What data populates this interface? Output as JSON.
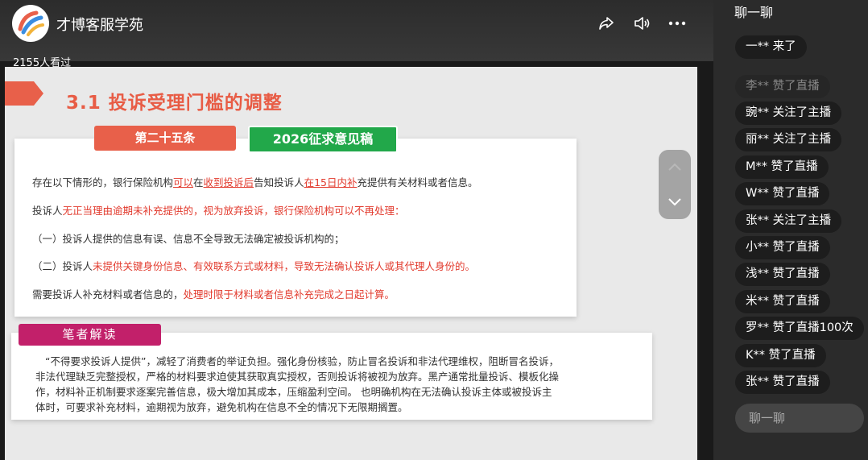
{
  "header": {
    "channel_name": "才博客服学苑",
    "viewers": "2155人看过",
    "share_icon": "share-icon",
    "volume_icon": "volume-icon",
    "more_icon": "more-icon"
  },
  "slide": {
    "title": "3.1 投诉受理门槛的调整",
    "tab_article": "第二十五条",
    "tab_draft": "2026征求意见稿",
    "p1": {
      "a": "存在以下情形的，银行保险机构",
      "b": "可以",
      "c": "在",
      "d": "收到投诉后",
      "e": "告知投诉人",
      "f": "在15日内补",
      "g": "充提供有关材料或者信息。"
    },
    "p2": {
      "a": "投诉人",
      "b": "无正当理由逾期未补充提供的，视为放弃投诉，银行保险机构可以不再处理："
    },
    "p3": "（一）投诉人提供的信息有误、信息不全导致无法确定被投诉机构的；",
    "p4": {
      "a": "（二）投诉人",
      "b": "未提供关键身份信息、有效联系方式或材料，导致无法确认投诉人或其代理人身份的。"
    },
    "p5": {
      "a": "需要投诉人补充材料或者信息的，",
      "b": "处理时限于材料或者信息补充完成之日起计算。"
    },
    "note_label": "笔者解读",
    "note_lines": [
      "“不得要求投诉人提供”，减轻了消费者的举证负担。强化身份核验，防止冒名投诉和非法代理维权，阻断冒名投诉，",
      "非法代理缺乏完整授权，严格的材料要求迫使其获取真实授权，否则投诉将被视为放弃。黑产通常批量投诉、模板化操",
      "作，材料补正机制要求逐案完善信息，极大增加其成本，压缩盈利空间。  也明确机构在无法确认投诉主体或被投诉主",
      "体时，可要求补充材料，逾期视为放弃，避免机构在信息不全的情况下无限期搁置。"
    ]
  },
  "chat": {
    "title": "聊一聊",
    "messages": [
      {
        "text": "一** 来了",
        "faded": false
      },
      {
        "text": "李** 赞了直播",
        "faded": true
      },
      {
        "text": "豌** 关注了主播",
        "faded": false
      },
      {
        "text": "丽** 关注了主播",
        "faded": false
      },
      {
        "text": "M** 赞了直播",
        "faded": false
      },
      {
        "text": "W** 赞了直播",
        "faded": false
      },
      {
        "text": "张** 关注了主播",
        "faded": false
      },
      {
        "text": "小** 赞了直播",
        "faded": false
      },
      {
        "text": "浅** 赞了直播",
        "faded": false
      },
      {
        "text": "米** 赞了直播",
        "faded": false
      },
      {
        "text": "罗** 赞了直播100次",
        "faded": false
      },
      {
        "text": "K** 赞了直播",
        "faded": false
      },
      {
        "text": "张** 赞了直播",
        "faded": false
      }
    ],
    "input_placeholder": "聊一聊"
  },
  "colors": {
    "accent_red": "#e85c45",
    "tab_green": "#22a84a",
    "note_magenta": "#c2206a",
    "highlight_red": "#e23b2e"
  }
}
